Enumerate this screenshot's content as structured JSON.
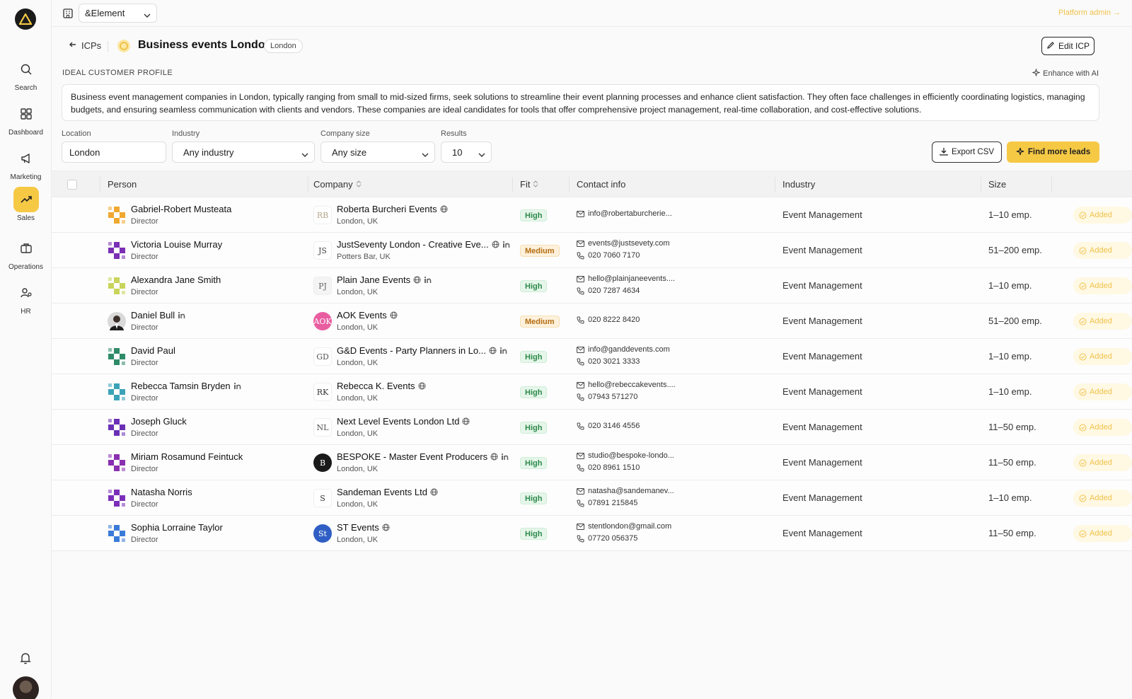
{
  "sidebar": {
    "items": [
      {
        "label": "Search",
        "icon": "search-icon"
      },
      {
        "label": "Dashboard",
        "icon": "dashboard-icon"
      },
      {
        "label": "Marketing",
        "icon": "megaphone-icon"
      },
      {
        "label": "Sales",
        "icon": "trending-up-icon",
        "active": true
      },
      {
        "label": "Operations",
        "icon": "briefcase-icon"
      },
      {
        "label": "HR",
        "icon": "people-icon"
      }
    ]
  },
  "topbar": {
    "org": "&Element",
    "platform_admin": "Platform admin →"
  },
  "header": {
    "back_label": "ICPs",
    "title": "Business events London",
    "location_pill": "London",
    "edit_label": "Edit ICP"
  },
  "icp": {
    "heading": "IDEAL CUSTOMER PROFILE",
    "enhance_label": "Enhance with AI",
    "description": "Business event management companies in London, typically ranging from small to mid-sized firms, seek solutions to streamline their event planning processes and enhance client satisfaction. They often face challenges in efficiently coordinating logistics, managing budgets, and ensuring seamless communication with clients and vendors. These companies are ideal candidates for tools that offer comprehensive project management, real-time collaboration, and cost-effective solutions."
  },
  "filters": {
    "location_label": "Location",
    "location_value": "London",
    "industry_label": "Industry",
    "industry_value": "Any industry",
    "size_label": "Company size",
    "size_value": "Any size",
    "results_label": "Results",
    "results_value": "10",
    "export_label": "Export CSV",
    "find_label": "Find more leads"
  },
  "table": {
    "headers": {
      "person": "Person",
      "company": "Company",
      "fit": "Fit",
      "contact": "Contact info",
      "industry": "Industry",
      "size": "Size"
    },
    "add_label": "Added",
    "rows": [
      {
        "name": "Gabriel-Robert Musteata",
        "role": "Director",
        "linkedin": false,
        "avatar_color": "#f0a830",
        "company": "Roberta Burcheri Events",
        "company_web": true,
        "company_li": false,
        "logo_text": "RB",
        "logo_bg": "#ffffff",
        "logo_fg": "#b5a68a",
        "loc": "London, UK",
        "fit": "High",
        "email": "info@robertaburcherie...",
        "phone": "",
        "industry": "Event Management",
        "size": "1–10 emp."
      },
      {
        "name": "Victoria Louise Murray",
        "role": "Director",
        "linkedin": false,
        "avatar_color": "#7a2fb5",
        "company": "JustSeventy London - Creative Eve...",
        "company_web": true,
        "company_li": true,
        "logo_text": "JS",
        "logo_bg": "#ffffff",
        "logo_fg": "#444444",
        "loc": "Potters Bar, UK",
        "fit": "Medium",
        "email": "events@justsevety.com",
        "phone": "020 7060 7170",
        "industry": "Event Management",
        "size": "51–200 emp."
      },
      {
        "name": "Alexandra Jane Smith",
        "role": "Director",
        "linkedin": false,
        "avatar_color": "#c9d45a",
        "company": "Plain Jane Events",
        "company_web": true,
        "company_li": true,
        "logo_text": "PJ",
        "logo_bg": "#f4f4f4",
        "logo_fg": "#666666",
        "loc": "London, UK",
        "fit": "High",
        "email": "hello@plainjaneevents....",
        "phone": "020 7287 4634",
        "industry": "Event Management",
        "size": "1–10 emp."
      },
      {
        "name": "Daniel Bull",
        "role": "Director",
        "linkedin": true,
        "avatar_color": "photo",
        "company": "AOK Events",
        "company_web": true,
        "company_li": false,
        "logo_text": "AOK",
        "logo_bg": "#e85da0",
        "logo_fg": "#ffffff",
        "loc": "London, UK",
        "fit": "Medium",
        "email": "",
        "phone": "020 8222 8420",
        "industry": "Event Management",
        "size": "51–200 emp."
      },
      {
        "name": "David Paul",
        "role": "Director",
        "linkedin": false,
        "avatar_color": "#2e8b68",
        "company": "G&D Events - Party Planners in Lo...",
        "company_web": true,
        "company_li": true,
        "logo_text": "GD",
        "logo_bg": "#ffffff",
        "logo_fg": "#555555",
        "loc": "London, UK",
        "fit": "High",
        "email": "info@ganddevents.com",
        "phone": "020 3021 3333",
        "industry": "Event Management",
        "size": "1–10 emp."
      },
      {
        "name": "Rebecca Tamsin Bryden",
        "role": "Director",
        "linkedin": true,
        "avatar_color": "#3aa3b8",
        "company": "Rebecca K. Events",
        "company_web": true,
        "company_li": false,
        "logo_text": "RK",
        "logo_bg": "#ffffff",
        "logo_fg": "#333333",
        "loc": "London, UK",
        "fit": "High",
        "email": "hello@rebeccakevents....",
        "phone": "07943 571270",
        "industry": "Event Management",
        "size": "1–10 emp."
      },
      {
        "name": "Joseph Gluck",
        "role": "Director",
        "linkedin": false,
        "avatar_color": "#6a2fb5",
        "company": "Next Level Events London Ltd",
        "company_web": true,
        "company_li": false,
        "logo_text": "NL",
        "logo_bg": "#ffffff",
        "logo_fg": "#555555",
        "loc": "London, UK",
        "fit": "High",
        "email": "",
        "phone": "020 3146 4556",
        "industry": "Event Management",
        "size": "11–50 emp."
      },
      {
        "name": "Miriam Rosamund Feintuck",
        "role": "Director",
        "linkedin": false,
        "avatar_color": "#8a2fb0",
        "company": "BESPOKE - Master Event Producers",
        "company_web": true,
        "company_li": true,
        "logo_text": "B",
        "logo_bg": "#1a1a1a",
        "logo_fg": "#ffffff",
        "loc": "London, UK",
        "fit": "High",
        "email": "studio@bespoke-londo...",
        "phone": "020 8961 1510",
        "industry": "Event Management",
        "size": "11–50 emp."
      },
      {
        "name": "Natasha Norris",
        "role": "Director",
        "linkedin": false,
        "avatar_color": "#7b2fb8",
        "company": "Sandeman Events Ltd",
        "company_web": true,
        "company_li": false,
        "logo_text": "S",
        "logo_bg": "#ffffff",
        "logo_fg": "#333333",
        "loc": "London, UK",
        "fit": "High",
        "email": "natasha@sandemanev...",
        "phone": "07891 215845",
        "industry": "Event Management",
        "size": "1–10 emp."
      },
      {
        "name": "Sophia Lorraine Taylor",
        "role": "Director",
        "linkedin": false,
        "avatar_color": "#3a7ad9",
        "company": "ST Events",
        "company_web": true,
        "company_li": false,
        "logo_text": "St",
        "logo_bg": "#2f5fc4",
        "logo_fg": "#ffffff",
        "loc": "London, UK",
        "fit": "High",
        "email": "stentlondon@gmail.com",
        "phone": "07720 056375",
        "industry": "Event Management",
        "size": "11–50 emp."
      }
    ]
  }
}
